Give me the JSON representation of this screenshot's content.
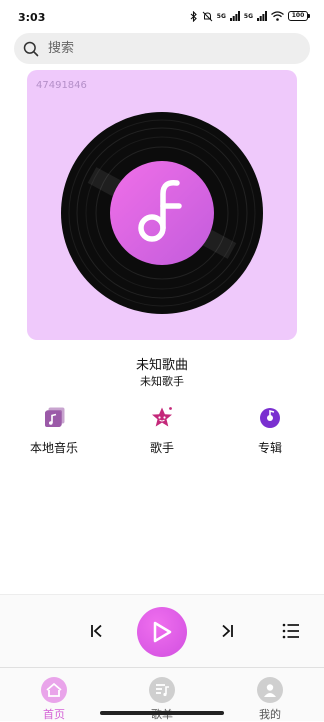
{
  "status_bar": {
    "time": "3:03",
    "network_1": "5G",
    "network_2": "5G",
    "battery": "100"
  },
  "search": {
    "placeholder": "搜索"
  },
  "cover": {
    "id_text": "47491846",
    "background_color": "#efc9fb",
    "logo_gradient": [
      "#f06fe8",
      "#c25cdc"
    ]
  },
  "now_playing": {
    "title": "未知歌曲",
    "artist": "未知歌手"
  },
  "quick_access": [
    {
      "label": "本地音乐",
      "icon": "local-music-icon",
      "color": "#9b5aa8"
    },
    {
      "label": "歌手",
      "icon": "singer-star-icon",
      "color": "#c4287a"
    },
    {
      "label": "专辑",
      "icon": "album-disc-icon",
      "color": "#7a2fd0"
    }
  ],
  "player": {
    "accent": "#e05fe8"
  },
  "nav": {
    "items": [
      {
        "label": "首页",
        "icon": "home-icon",
        "active": true
      },
      {
        "label": "歌单",
        "icon": "playlist-icon",
        "active": false
      },
      {
        "label": "我的",
        "icon": "profile-icon",
        "active": false
      }
    ],
    "active_color": "#d45fd6",
    "inactive_color": "#555555"
  }
}
